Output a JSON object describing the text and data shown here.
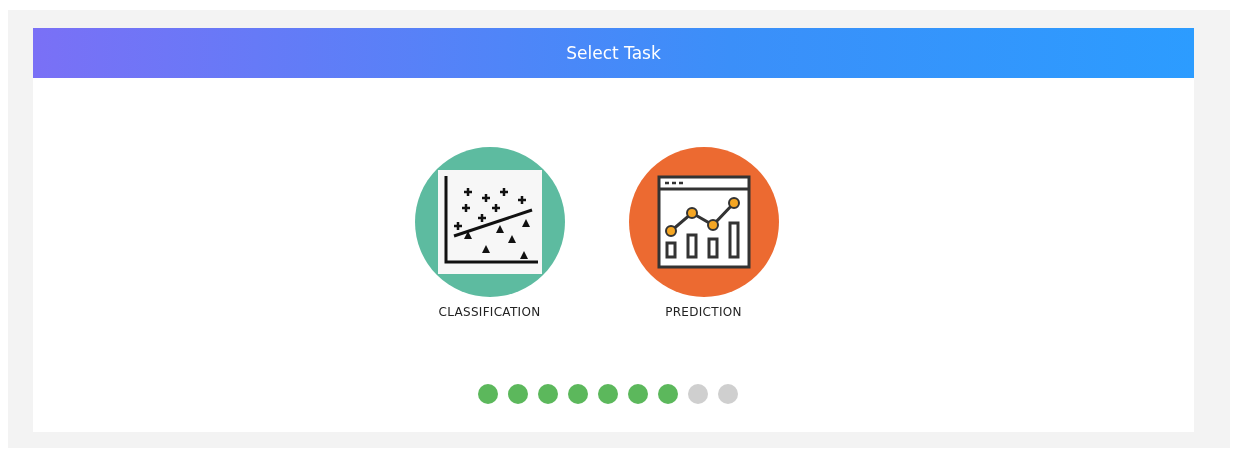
{
  "header": {
    "title": "Select Task"
  },
  "tasks": [
    {
      "kind": "classification",
      "label": "CLASSIFICATION",
      "color": "#5dbba0"
    },
    {
      "kind": "prediction",
      "label": "PREDICTION",
      "color": "#ec6a31"
    }
  ],
  "steps": [
    {
      "done": true
    },
    {
      "done": true
    },
    {
      "done": true
    },
    {
      "done": true
    },
    {
      "done": true
    },
    {
      "done": true
    },
    {
      "done": true
    },
    {
      "done": false
    },
    {
      "done": false
    }
  ]
}
